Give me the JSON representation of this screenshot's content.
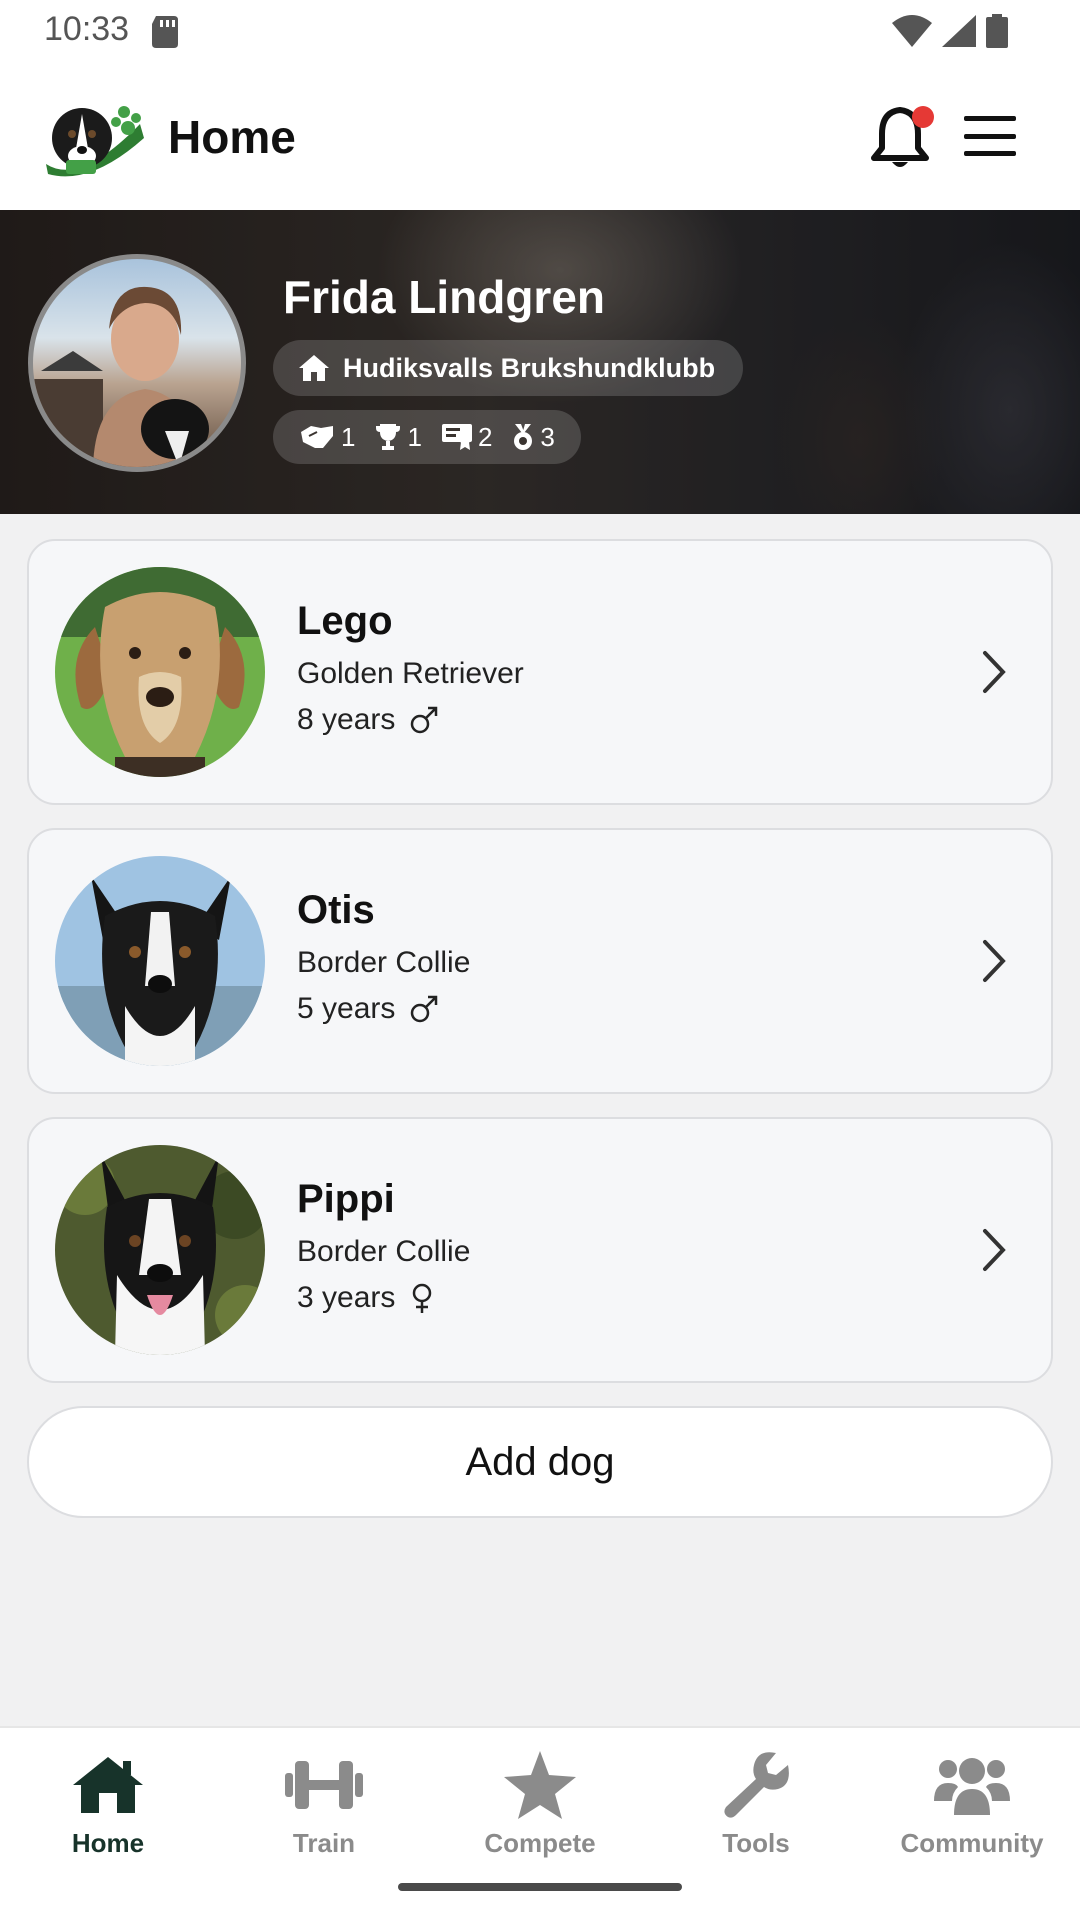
{
  "status_bar": {
    "time": "10:33"
  },
  "header": {
    "title": "Home"
  },
  "profile": {
    "name": "Frida Lindgren",
    "club": "Hudiksvalls Brukshundklubb",
    "stats": [
      {
        "icon": "handshake-icon",
        "value": "1"
      },
      {
        "icon": "trophy-icon",
        "value": "1"
      },
      {
        "icon": "certificate-icon",
        "value": "2"
      },
      {
        "icon": "medal-icon",
        "value": "3"
      }
    ]
  },
  "dogs": [
    {
      "name": "Lego",
      "breed": "Golden Retriever",
      "age": "8 years",
      "sex_icon": "male-icon"
    },
    {
      "name": "Otis",
      "breed": "Border Collie",
      "age": "5 years",
      "sex_icon": "male-icon"
    },
    {
      "name": "Pippi",
      "breed": "Border Collie",
      "age": "3 years",
      "sex_icon": "female-icon"
    }
  ],
  "add_dog_label": "Add dog",
  "nav": {
    "items": [
      {
        "label": "Home",
        "icon": "home-icon",
        "active": true
      },
      {
        "label": "Train",
        "icon": "dumbbell-icon",
        "active": false
      },
      {
        "label": "Compete",
        "icon": "star-icon",
        "active": false
      },
      {
        "label": "Tools",
        "icon": "wrench-icon",
        "active": false
      },
      {
        "label": "Community",
        "icon": "users-icon",
        "active": false
      }
    ]
  },
  "colors": {
    "accent_active": "#17332a",
    "inactive": "#8b8b8b",
    "notification_dot": "#e53935",
    "card_bg": "#f6f7f9"
  }
}
